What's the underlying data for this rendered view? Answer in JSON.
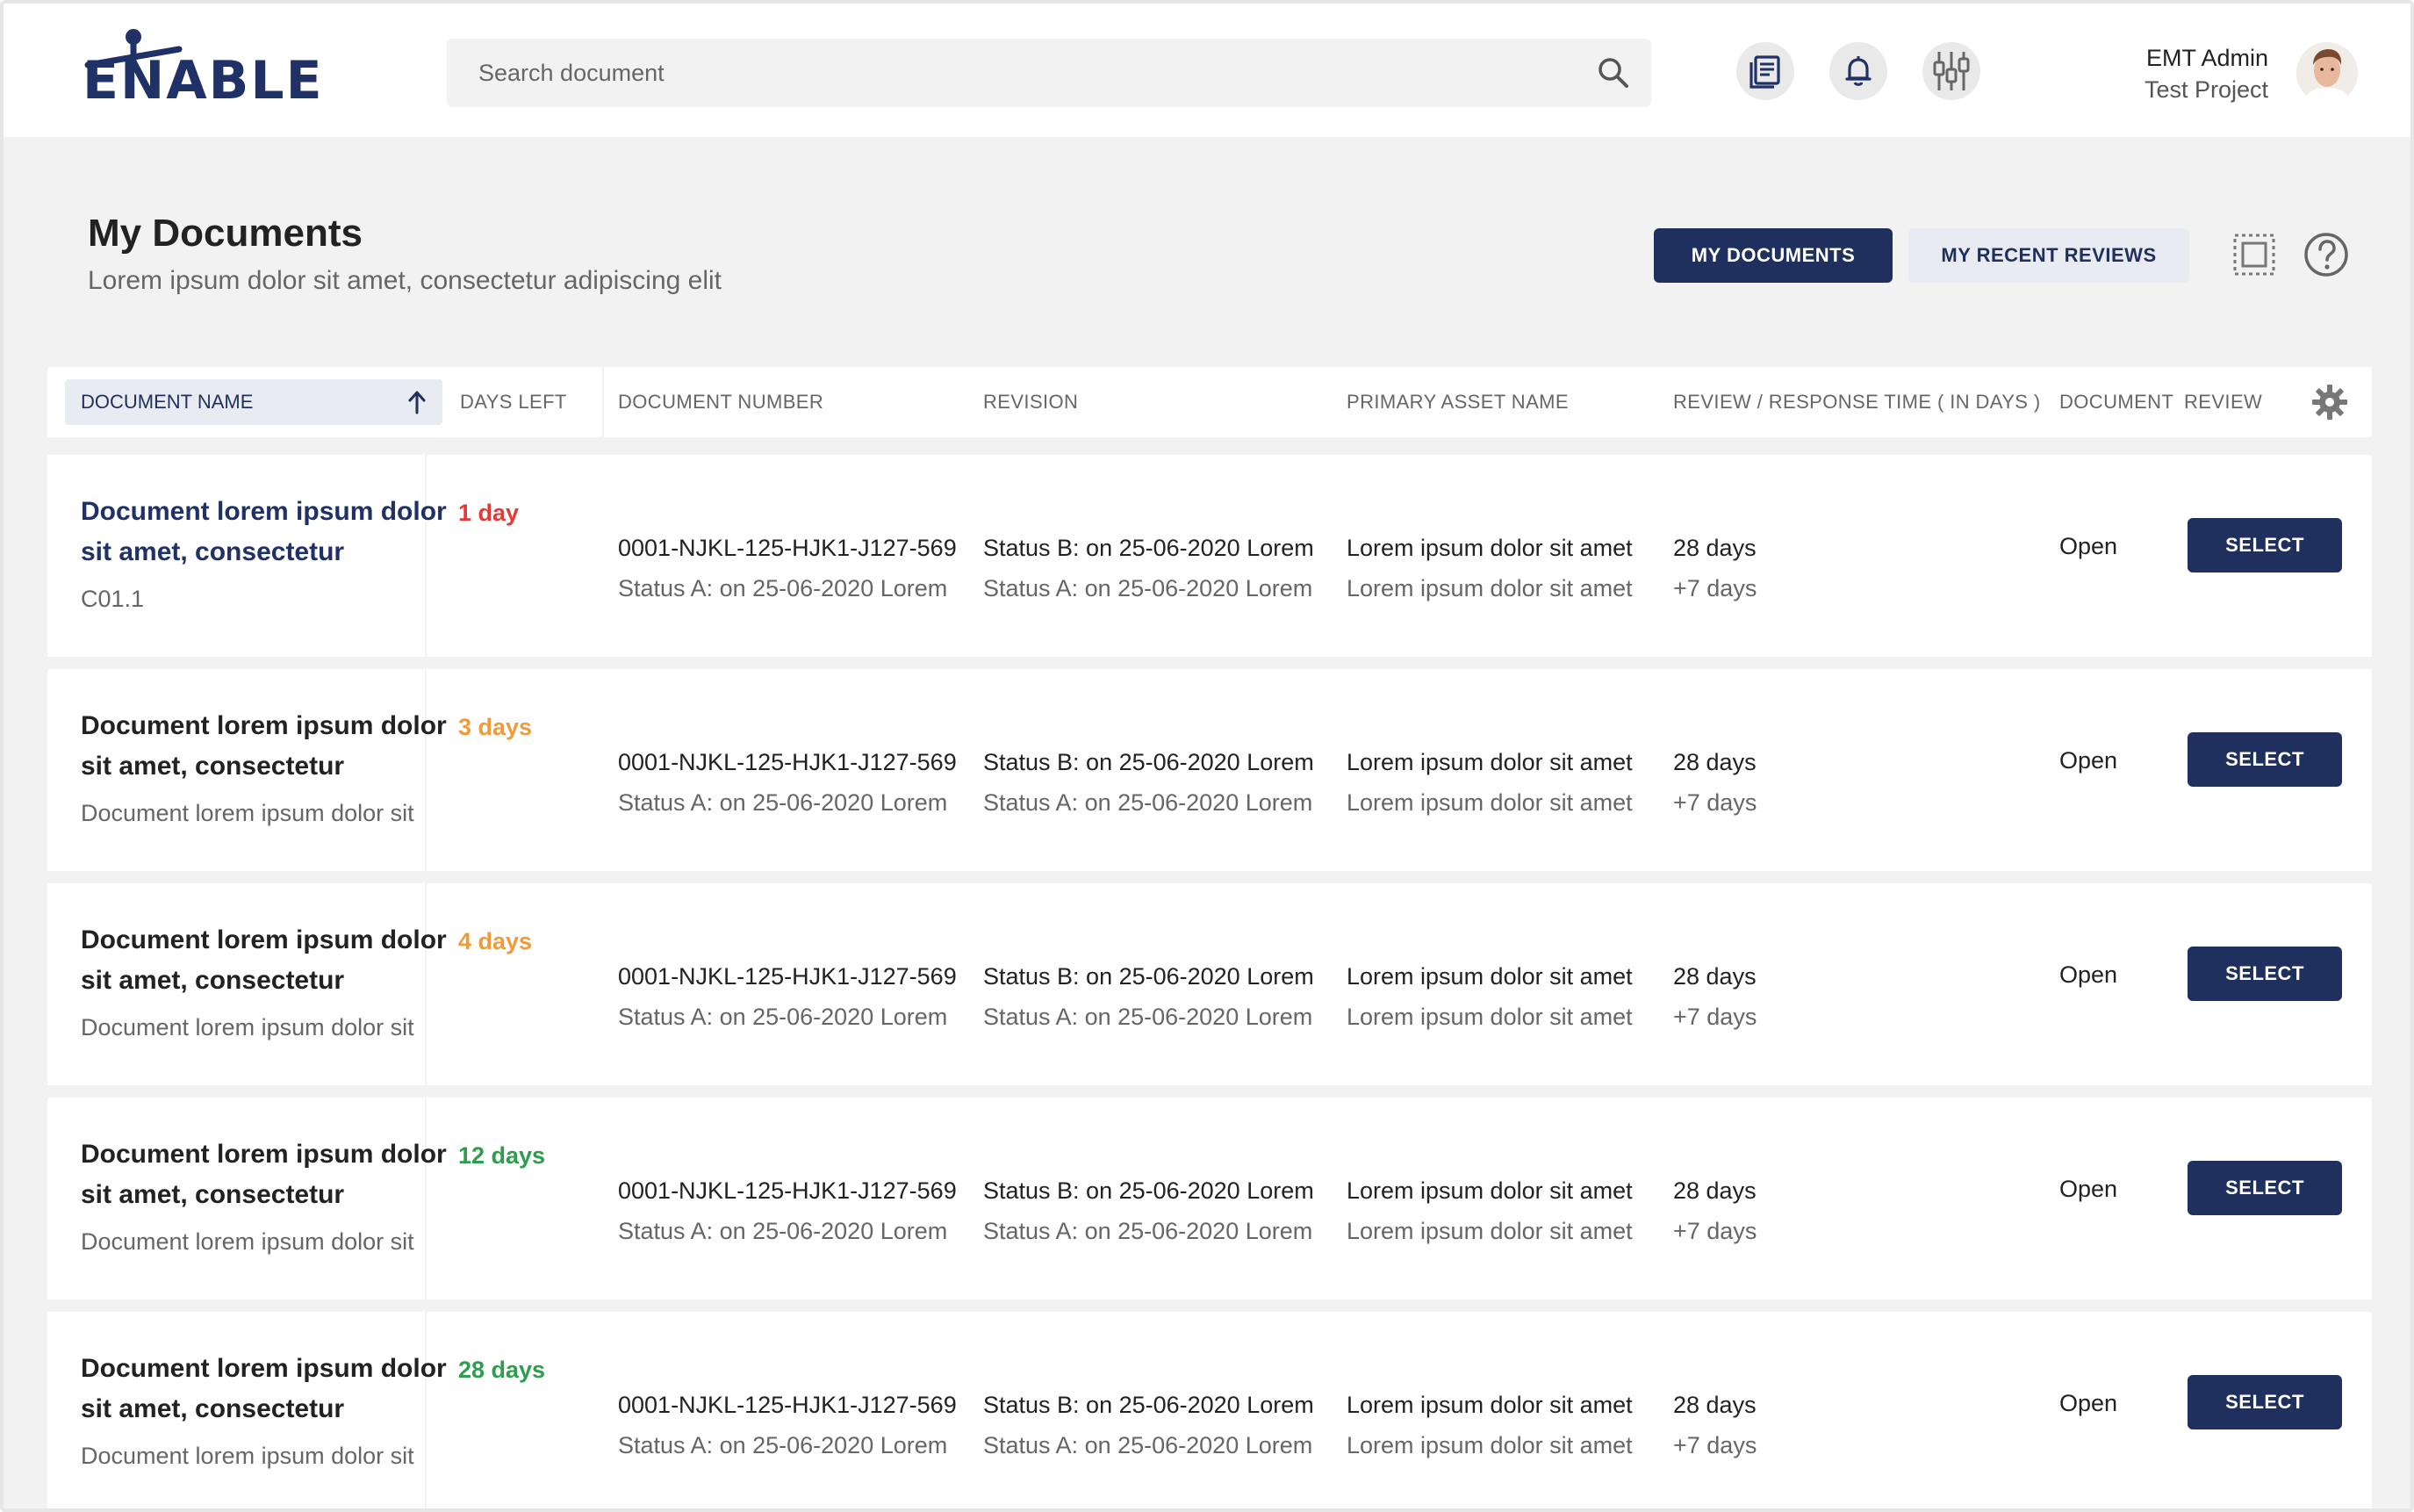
{
  "header": {
    "logo_text": "ENABLE",
    "search_placeholder": "Search document",
    "icons": [
      "document-list-icon",
      "bell-icon",
      "equalizer-icon"
    ],
    "user": {
      "name": "EMT Admin",
      "project": "Test Project"
    }
  },
  "page": {
    "title": "My Documents",
    "subtitle": "Lorem ipsum dolor sit amet, consectetur adipiscing elit",
    "tabs": [
      {
        "label": "MY DOCUMENTS",
        "active": true
      },
      {
        "label": "MY RECENT REVIEWS",
        "active": false
      }
    ]
  },
  "table": {
    "columns": {
      "document_name": "DOCUMENT NAME",
      "days_left": "DAYS LEFT",
      "document_number": "DOCUMENT NUMBER",
      "revision": "REVISION",
      "primary_asset_name": "PRIMARY ASSET NAME",
      "review_response_time": "REVIEW / RESPONSE TIME ( IN DAYS )",
      "document": "DOCUMENT",
      "review": "REVIEW"
    },
    "rows": [
      {
        "title": "Document lorem ipsum dolor sit amet, consectetur",
        "subtitle": "C01.1",
        "days_left": "1 day",
        "days_color": "#e53935",
        "doc_number": "0001-NJKL-125-HJK1-J127-569",
        "doc_number_sub": "Status A: on 25-06-2020 Lorem",
        "revision": "Status B: on 25-06-2020 Lorem",
        "revision_sub": "Status A: on 25-06-2020 Lorem",
        "asset": "Lorem ipsum dolor sit amet",
        "asset_sub": "Lorem ipsum dolor sit amet",
        "review_time": "28 days",
        "response_time": "+7 days",
        "status": "Open",
        "action": "SELECT"
      },
      {
        "title": "Document lorem ipsum dolor sit amet, consectetur",
        "subtitle": "Document lorem ipsum dolor sit",
        "days_left": "3 days",
        "days_color": "#f09a3a",
        "doc_number": "0001-NJKL-125-HJK1-J127-569",
        "doc_number_sub": "Status A: on 25-06-2020 Lorem",
        "revision": "Status B: on 25-06-2020 Lorem",
        "revision_sub": "Status A: on 25-06-2020 Lorem",
        "asset": "Lorem ipsum dolor sit amet",
        "asset_sub": "Lorem ipsum dolor sit amet",
        "review_time": "28 days",
        "response_time": "+7 days",
        "status": "Open",
        "action": "SELECT"
      },
      {
        "title": "Document lorem ipsum dolor sit amet, consectetur",
        "subtitle": "Document lorem ipsum dolor sit",
        "days_left": "4 days",
        "days_color": "#f09a3a",
        "doc_number": "0001-NJKL-125-HJK1-J127-569",
        "doc_number_sub": "Status A: on 25-06-2020 Lorem",
        "revision": "Status B: on 25-06-2020 Lorem",
        "revision_sub": "Status A: on 25-06-2020 Lorem",
        "asset": "Lorem ipsum dolor sit amet",
        "asset_sub": "Lorem ipsum dolor sit amet",
        "review_time": "28 days",
        "response_time": "+7 days",
        "status": "Open",
        "action": "SELECT"
      },
      {
        "title": "Document lorem ipsum dolor sit amet, consectetur",
        "subtitle": "Document lorem ipsum dolor sit",
        "days_left": "12 days",
        "days_color": "#2e9d4e",
        "doc_number": "0001-NJKL-125-HJK1-J127-569",
        "doc_number_sub": "Status A: on 25-06-2020 Lorem",
        "revision": "Status B: on 25-06-2020 Lorem",
        "revision_sub": "Status A: on 25-06-2020 Lorem",
        "asset": "Lorem ipsum dolor sit amet",
        "asset_sub": "Lorem ipsum dolor sit amet",
        "review_time": "28 days",
        "response_time": "+7 days",
        "status": "Open",
        "action": "SELECT"
      },
      {
        "title": "Document lorem ipsum dolor sit amet, consectetur",
        "subtitle": "Document lorem ipsum dolor sit",
        "days_left": "28 days",
        "days_color": "#2e9d4e",
        "doc_number": "0001-NJKL-125-HJK1-J127-569",
        "doc_number_sub": "Status A: on 25-06-2020 Lorem",
        "revision": "Status B: on 25-06-2020 Lorem",
        "revision_sub": "Status A: on 25-06-2020 Lorem",
        "asset": "Lorem ipsum dolor sit amet",
        "asset_sub": "Lorem ipsum dolor sit amet",
        "review_time": "28 days",
        "response_time": "+7 days",
        "status": "Open",
        "action": "SELECT"
      }
    ]
  },
  "colors": {
    "primary": "#1f2f5e",
    "background": "#f2f2f2",
    "urgent": "#e53935",
    "warning": "#f09a3a",
    "ok": "#2e9d4e"
  }
}
